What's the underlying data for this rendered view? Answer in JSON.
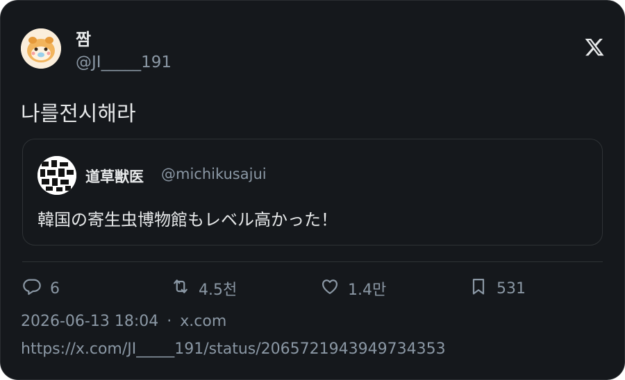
{
  "tweet": {
    "author_name": "짬",
    "author_handle": "@JI_____191",
    "text": "나를전시해라"
  },
  "quoted": {
    "author_name": "道草獣医",
    "author_handle": "@michikusajui",
    "text": "韓国の寄生虫博物館もレベル高かった！"
  },
  "actions": {
    "replies": "6",
    "retweets": "4.5천",
    "likes": "1.4만",
    "bookmarks": "531"
  },
  "meta": {
    "timestamp": "2026-06-13 18:04",
    "separator": "·",
    "source": "x.com",
    "url": "https://x.com/JI_____191/status/2065721943949734353"
  },
  "icons": {
    "brand": "x-logo-icon",
    "reply": "reply-icon",
    "retweet": "retweet-icon",
    "like": "heart-icon",
    "bookmark": "bookmark-icon"
  },
  "colors": {
    "card_bg": "#15181c",
    "text_primary": "#e7e9ea",
    "text_secondary": "#8b98a5"
  }
}
